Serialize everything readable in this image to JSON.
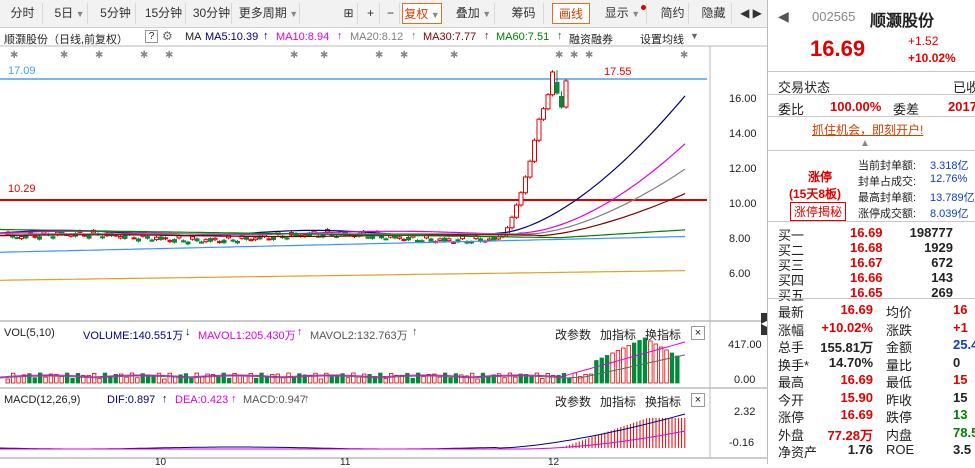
{
  "toolbar": {
    "items": [
      {
        "label": "分时"
      },
      {
        "label": "5日",
        "caret": "▼"
      },
      {
        "label": "5分钟"
      },
      {
        "label": "15分钟"
      },
      {
        "label": "30分钟"
      },
      {
        "label": "更多周期",
        "caret": "▼"
      },
      {
        "label": "复权",
        "caret": "▼"
      },
      {
        "label": "叠加",
        "caret": "▼"
      },
      {
        "label": "筹码"
      },
      {
        "label": "画线"
      },
      {
        "label": "显示",
        "caret": "▼"
      },
      {
        "label": "简约"
      },
      {
        "label": "隐藏"
      }
    ],
    "lock_glyph": "⊞",
    "plus_glyph": "+",
    "minus_glyph": "−"
  },
  "legend": {
    "title": "顺灏股份（日线,前复权）",
    "help": "?",
    "ma_label": "MA",
    "ma5": "MA5:10.39",
    "ma10": "MA10:8.94",
    "ma20": "MA20:8.12",
    "ma30": "MA30:7.77",
    "ma60": "MA60:7.51",
    "margin": "融资融券",
    "setting": "设置均线",
    "arrow_up": "↑",
    "arrow_down": "↓"
  },
  "price_chart": {
    "line_high_label": "17.09",
    "line_low_label": "10.29",
    "peak_label": "17.55",
    "y_ticks": [
      "16.00",
      "14.00",
      "12.00",
      "10.00",
      "8.00",
      "6.00"
    ]
  },
  "vol_panel": {
    "name": "VOL(5,10)",
    "volume": "VOLUME:140.551万",
    "mavol1": "MAVOL1:205.430万",
    "mavol2": "MAVOL2:132.763万",
    "y_top": "417.00",
    "y_bottom": "0.00"
  },
  "macd_panel": {
    "name": "MACD(12,26,9)",
    "dif": "DIF:0.897",
    "dea": "DEA:0.423",
    "macd": "MACD:0.947",
    "y_top": "2.32",
    "y_bottom": "-0.16"
  },
  "panel_links": {
    "param": "改参数",
    "add": "加指标",
    "swap": "换指标",
    "close": "×"
  },
  "x_axis": [
    "10",
    "11",
    "12"
  ],
  "stock": {
    "code": "002565",
    "name": "顺灏股份",
    "price": "16.69",
    "change": "+1.52",
    "pct": "+10.02%",
    "trade_status_label": "交易状态",
    "trade_status_value": "已收",
    "weibi_label": "委比",
    "weibi_value": "100.00%",
    "weicha_label": "委差",
    "weicha_value": "2017",
    "promo": "抓住机会，即刻开户!",
    "limit_tag": "涨停",
    "limit_days": "(15天8板)",
    "limit_reveal": "涨停揭秘",
    "seal_rows": [
      {
        "label": "当前封单额:",
        "value": "3.318亿"
      },
      {
        "label": "封单占成交:",
        "value": "12.76%"
      },
      {
        "label": "最高封单额:",
        "value": "13.789亿"
      },
      {
        "label": "涨停成交额:",
        "value": "8.039亿"
      }
    ],
    "order_book": [
      {
        "label": "买一",
        "price": "16.69",
        "vol": "198777"
      },
      {
        "label": "买二",
        "price": "16.68",
        "vol": "1929"
      },
      {
        "label": "买三",
        "price": "16.67",
        "vol": "672"
      },
      {
        "label": "买四",
        "price": "16.66",
        "vol": "143"
      },
      {
        "label": "买五",
        "price": "16.65",
        "vol": "269"
      }
    ],
    "stats": [
      {
        "l1": "最新",
        "v1": "16.69",
        "c1": "red",
        "l2": "均价",
        "v2": "16",
        "c2": "red"
      },
      {
        "l1": "涨幅",
        "v1": "+10.02%",
        "c1": "red",
        "l2": "涨跌",
        "v2": "+1",
        "c2": "red"
      },
      {
        "l1": "总手",
        "v1": "155.81万",
        "c1": "blk",
        "l2": "金额",
        "v2": "25.4",
        "c2": "blue"
      },
      {
        "l1": "换手*",
        "v1": "14.70%",
        "c1": "blk",
        "l2": "量比",
        "v2": "0",
        "c2": "blk"
      },
      {
        "l1": "最高",
        "v1": "16.69",
        "c1": "red",
        "l2": "最低",
        "v2": "15",
        "c2": "red"
      },
      {
        "l1": "今开",
        "v1": "15.90",
        "c1": "red",
        "l2": "昨收",
        "v2": "15",
        "c2": "blk"
      },
      {
        "l1": "涨停",
        "v1": "16.69",
        "c1": "red",
        "l2": "跌停",
        "v2": "13",
        "c2": "green"
      },
      {
        "l1": "外盘",
        "v1": "77.28万",
        "c1": "red",
        "l2": "内盘",
        "v2": "78.5",
        "c2": "green"
      },
      {
        "l1": "净资产",
        "v1": "1.76",
        "c1": "blk",
        "l2": "ROE",
        "v2": "3.5",
        "c2": "blk"
      }
    ]
  },
  "colors": {
    "up": "#e00000",
    "down": "#008a3a",
    "ma5": "#000080",
    "ma10": "#e000e0",
    "ma20": "#808080",
    "ma30": "#800000",
    "ma60": "#008000",
    "ma_long": "#4090ff",
    "ma_year": "#e0a020",
    "hline_high": "#4aa0e8",
    "hline_low": "#e00000"
  }
}
